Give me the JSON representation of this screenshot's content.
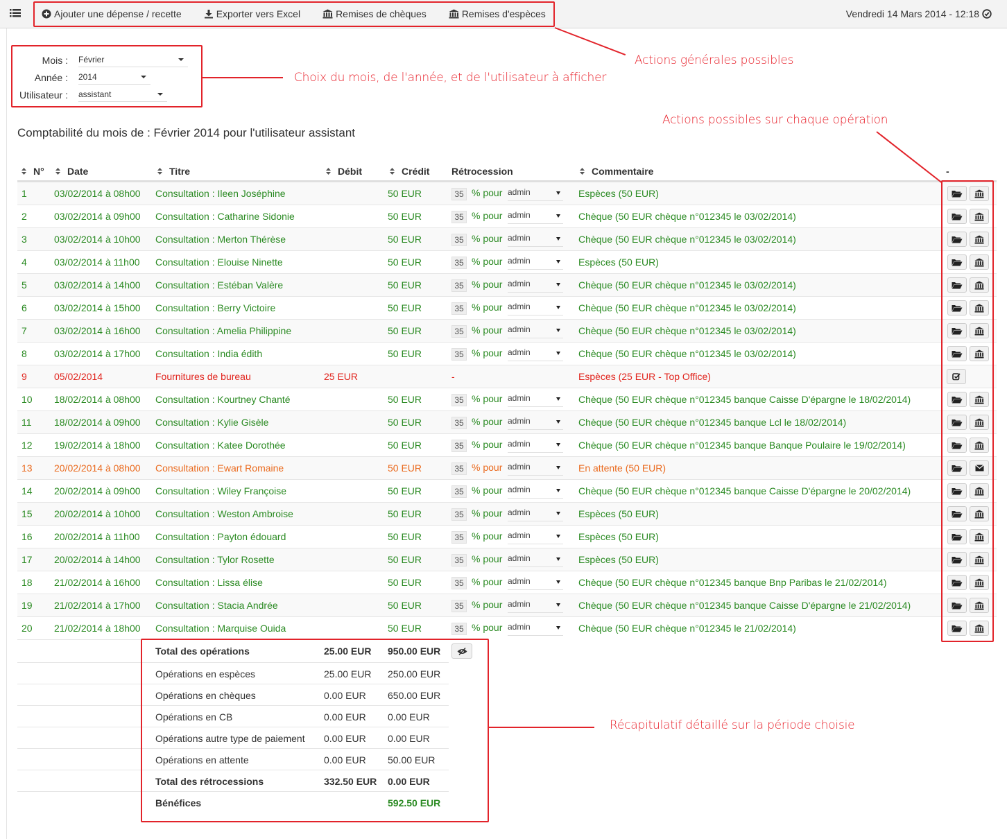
{
  "topbar": {
    "nav": [
      {
        "label": "Ajouter une dépense / recette",
        "icon": "plus-circle-icon"
      },
      {
        "label": "Exporter vers Excel",
        "icon": "download-icon"
      },
      {
        "label": "Remises de chèques",
        "icon": "bank-icon"
      },
      {
        "label": "Remises d'espèces",
        "icon": "bank-icon"
      }
    ],
    "datetime": "Vendredi 14 Mars 2014 - 12:18"
  },
  "filters": {
    "month_label": "Mois :",
    "month_value": "Février",
    "year_label": "Année :",
    "year_value": "2014",
    "user_label": "Utilisateur :",
    "user_value": "assistant"
  },
  "heading": "Comptabilité du mois de : Février 2014 pour l'utilisateur assistant",
  "annotations": {
    "general": "Actions générales possibles",
    "choice": "Choix du mois, de l'année, et de l'utilisateur à afficher",
    "per_op": "Actions possibles sur chaque opération",
    "summary": "Récapitulatif détaillé sur la période choisie"
  },
  "table": {
    "columns": {
      "num": "N°",
      "date": "Date",
      "title": "Titre",
      "debit": "Débit",
      "credit": "Crédit",
      "retro": "Rétrocession",
      "comment": "Commentaire",
      "actions": "-"
    },
    "pour_label": "% pour",
    "rows": [
      {
        "n": "1",
        "date": "03/02/2014 à 08h00",
        "title": "Consultation : Ileen Joséphine",
        "debit": "",
        "credit": "50 EUR",
        "pct": "35",
        "who": "admin",
        "comment": "Espèces (50 EUR)",
        "status": "green",
        "action": "bank"
      },
      {
        "n": "2",
        "date": "03/02/2014 à 09h00",
        "title": "Consultation : Catharine Sidonie",
        "debit": "",
        "credit": "50 EUR",
        "pct": "35",
        "who": "admin",
        "comment": "Chèque (50 EUR chèque n°012345 le 03/02/2014)",
        "status": "green",
        "action": "bank"
      },
      {
        "n": "3",
        "date": "03/02/2014 à 10h00",
        "title": "Consultation : Merton Thérèse",
        "debit": "",
        "credit": "50 EUR",
        "pct": "35",
        "who": "admin",
        "comment": "Chèque (50 EUR chèque n°012345 le 03/02/2014)",
        "status": "green",
        "action": "bank"
      },
      {
        "n": "4",
        "date": "03/02/2014 à 11h00",
        "title": "Consultation : Elouise Ninette",
        "debit": "",
        "credit": "50 EUR",
        "pct": "35",
        "who": "admin",
        "comment": "Espèces (50 EUR)",
        "status": "green",
        "action": "bank"
      },
      {
        "n": "5",
        "date": "03/02/2014 à 14h00",
        "title": "Consultation : Estéban Valère",
        "debit": "",
        "credit": "50 EUR",
        "pct": "35",
        "who": "admin",
        "comment": "Chèque (50 EUR chèque n°012345 le 03/02/2014)",
        "status": "green",
        "action": "bank"
      },
      {
        "n": "6",
        "date": "03/02/2014 à 15h00",
        "title": "Consultation : Berry Victoire",
        "debit": "",
        "credit": "50 EUR",
        "pct": "35",
        "who": "admin",
        "comment": "Chèque (50 EUR chèque n°012345 le 03/02/2014)",
        "status": "green",
        "action": "bank"
      },
      {
        "n": "7",
        "date": "03/02/2014 à 16h00",
        "title": "Consultation : Amelia Philippine",
        "debit": "",
        "credit": "50 EUR",
        "pct": "35",
        "who": "admin",
        "comment": "Chèque (50 EUR chèque n°012345 le 03/02/2014)",
        "status": "green",
        "action": "bank"
      },
      {
        "n": "8",
        "date": "03/02/2014 à 17h00",
        "title": "Consultation : India édith",
        "debit": "",
        "credit": "50 EUR",
        "pct": "35",
        "who": "admin",
        "comment": "Chèque (50 EUR chèque n°012345 le 03/02/2014)",
        "status": "green",
        "action": "bank"
      },
      {
        "n": "9",
        "date": "05/02/2014",
        "title": "Fournitures de bureau",
        "debit": "25 EUR",
        "credit": "",
        "pct": "",
        "who": "",
        "retro_text": "-",
        "comment": "Espèces (25 EUR - Top Office)",
        "status": "red",
        "action": "edit"
      },
      {
        "n": "10",
        "date": "18/02/2014 à 08h00",
        "title": "Consultation : Kourtney Chanté",
        "debit": "",
        "credit": "50 EUR",
        "pct": "35",
        "who": "admin",
        "comment": "Chèque (50 EUR chèque n°012345 banque Caisse D'épargne le 18/02/2014)",
        "status": "green",
        "action": "bank"
      },
      {
        "n": "11",
        "date": "18/02/2014 à 09h00",
        "title": "Consultation : Kylie Gisèle",
        "debit": "",
        "credit": "50 EUR",
        "pct": "35",
        "who": "admin",
        "comment": "Chèque (50 EUR chèque n°012345 banque Lcl le 18/02/2014)",
        "status": "green",
        "action": "bank"
      },
      {
        "n": "12",
        "date": "19/02/2014 à 18h00",
        "title": "Consultation : Katee Dorothée",
        "debit": "",
        "credit": "50 EUR",
        "pct": "35",
        "who": "admin",
        "comment": "Chèque (50 EUR chèque n°012345 banque Banque Poulaire le 19/02/2014)",
        "status": "green",
        "action": "bank"
      },
      {
        "n": "13",
        "date": "20/02/2014 à 08h00",
        "title": "Consultation : Ewart Romaine",
        "debit": "",
        "credit": "50 EUR",
        "pct": "35",
        "who": "admin",
        "comment": "En attente (50 EUR)",
        "status": "orange",
        "action": "mail"
      },
      {
        "n": "14",
        "date": "20/02/2014 à 09h00",
        "title": "Consultation : Wiley Françoise",
        "debit": "",
        "credit": "50 EUR",
        "pct": "35",
        "who": "admin",
        "comment": "Chèque (50 EUR chèque n°012345 banque Caisse D'épargne le 20/02/2014)",
        "status": "green",
        "action": "bank"
      },
      {
        "n": "15",
        "date": "20/02/2014 à 10h00",
        "title": "Consultation : Weston Ambroise",
        "debit": "",
        "credit": "50 EUR",
        "pct": "35",
        "who": "admin",
        "comment": "Espèces (50 EUR)",
        "status": "green",
        "action": "bank"
      },
      {
        "n": "16",
        "date": "20/02/2014 à 11h00",
        "title": "Consultation : Payton édouard",
        "debit": "",
        "credit": "50 EUR",
        "pct": "35",
        "who": "admin",
        "comment": "Espèces (50 EUR)",
        "status": "green",
        "action": "bank"
      },
      {
        "n": "17",
        "date": "20/02/2014 à 14h00",
        "title": "Consultation : Tylor Rosette",
        "debit": "",
        "credit": "50 EUR",
        "pct": "35",
        "who": "admin",
        "comment": "Espèces (50 EUR)",
        "status": "green",
        "action": "bank"
      },
      {
        "n": "18",
        "date": "21/02/2014 à 16h00",
        "title": "Consultation : Lissa élise",
        "debit": "",
        "credit": "50 EUR",
        "pct": "35",
        "who": "admin",
        "comment": "Chèque (50 EUR chèque n°012345 banque Bnp Paribas le 21/02/2014)",
        "status": "green",
        "action": "bank"
      },
      {
        "n": "19",
        "date": "21/02/2014 à 17h00",
        "title": "Consultation : Stacia Andrée",
        "debit": "",
        "credit": "50 EUR",
        "pct": "35",
        "who": "admin",
        "comment": "Chèque (50 EUR chèque n°012345 banque Caisse D'épargne le 21/02/2014)",
        "status": "green",
        "action": "bank"
      },
      {
        "n": "20",
        "date": "21/02/2014 à 18h00",
        "title": "Consultation : Marquise Ouida",
        "debit": "",
        "credit": "50 EUR",
        "pct": "35",
        "who": "admin",
        "comment": "Chèque (50 EUR chèque n°012345 le 21/02/2014)",
        "status": "green",
        "action": "bank"
      }
    ]
  },
  "summary": [
    {
      "label": "Total des opérations",
      "debit": "25.00 EUR",
      "credit": "950.00 EUR",
      "bold": true,
      "eye": true
    },
    {
      "label": "Opérations en espèces",
      "debit": "25.00 EUR",
      "credit": "250.00 EUR"
    },
    {
      "label": "Opérations en chèques",
      "debit": "0.00 EUR",
      "credit": "650.00 EUR"
    },
    {
      "label": "Opérations en CB",
      "debit": "0.00 EUR",
      "credit": "0.00 EUR"
    },
    {
      "label": "Opérations autre type de paiement",
      "debit": "0.00 EUR",
      "credit": "0.00 EUR"
    },
    {
      "label": "Opérations en attente",
      "debit": "0.00 EUR",
      "credit": "50.00 EUR"
    },
    {
      "label": "Total des rétrocessions",
      "debit": "332.50 EUR",
      "credit": "0.00 EUR",
      "bold": true
    },
    {
      "label": "Bénéfices",
      "debit": "",
      "credit": "592.50 EUR",
      "bold": true,
      "green": true
    }
  ],
  "colors": {
    "green": "#2a8a22",
    "red": "#e1231c",
    "orange": "#ea6a1e",
    "annotation": "#e2232a"
  }
}
